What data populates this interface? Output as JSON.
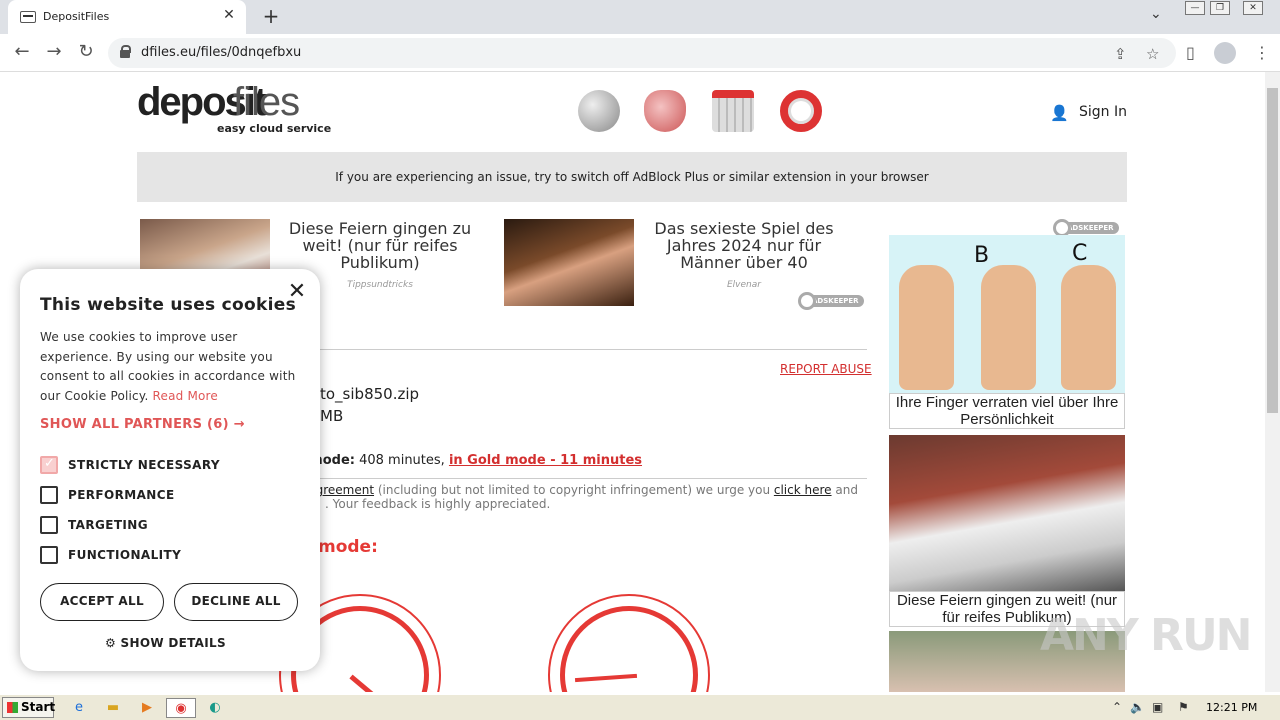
{
  "browser": {
    "tab_title": "DepositFiles",
    "tab_close": "✕",
    "new_tab": "+",
    "url": "dfiles.eu/files/0dnqefbxu"
  },
  "site": {
    "logo_bold": "deposit",
    "logo_light": "files",
    "logo_tagline": "easy cloud service",
    "sign_in": "Sign In",
    "banner": "If you are experiencing an issue, try to switch off AdBlock Plus or similar extension in your browser"
  },
  "ads": [
    {
      "title": "Diese Feiern gingen zu weit! (nur für reifes Publikum)",
      "source": "Tippsundtricks"
    },
    {
      "title": "Das sexieste Spiel des Jahres 2024 nur für Männer über 40",
      "source": "Elvenar"
    }
  ],
  "adskeeper_label": "ADSKEEPER",
  "right_ads": [
    {
      "caption": "Ihre Finger verraten viel über Ihre Persönlichkeit",
      "letters": [
        "B",
        "C"
      ]
    },
    {
      "caption": "Diese Feiern gingen zu weit! (nur für reifes Publikum)"
    }
  ],
  "file": {
    "report_abuse": "REPORT ABUSE",
    "name_partial": "to_sib850.zip",
    "size_partial": "MB",
    "mode_label": "lar mode:",
    "mode_value": " 408 minutes, ",
    "gold_link": "in Gold mode - 11 minutes",
    "agreement_link": "ser Agreement",
    "agreement_text": " (including but not limited to copyright infringement) we urge you ",
    "click_here": "click here",
    "agreement_end": " and",
    "feedback": ". Your feedback is highly appreciated.",
    "mode_heading": "mode:"
  },
  "cookie": {
    "title": "This website uses cookies",
    "close": "✕",
    "text": "We use cookies to improve user experience. By using our website you consent to all cookies in accordance with our Cookie Policy.",
    "read_more": "Read More",
    "partners": "SHOW ALL PARTNERS (6) →",
    "options": [
      {
        "label": "STRICTLY NECESSARY",
        "checked": true
      },
      {
        "label": "PERFORMANCE",
        "checked": false
      },
      {
        "label": "TARGETING",
        "checked": false
      },
      {
        "label": "FUNCTIONALITY",
        "checked": false
      }
    ],
    "accept": "ACCEPT ALL",
    "decline": "DECLINE ALL",
    "details": "SHOW DETAILS"
  },
  "taskbar": {
    "start": "Start",
    "clock": "12:21 PM"
  },
  "watermark": "ANY RUN"
}
